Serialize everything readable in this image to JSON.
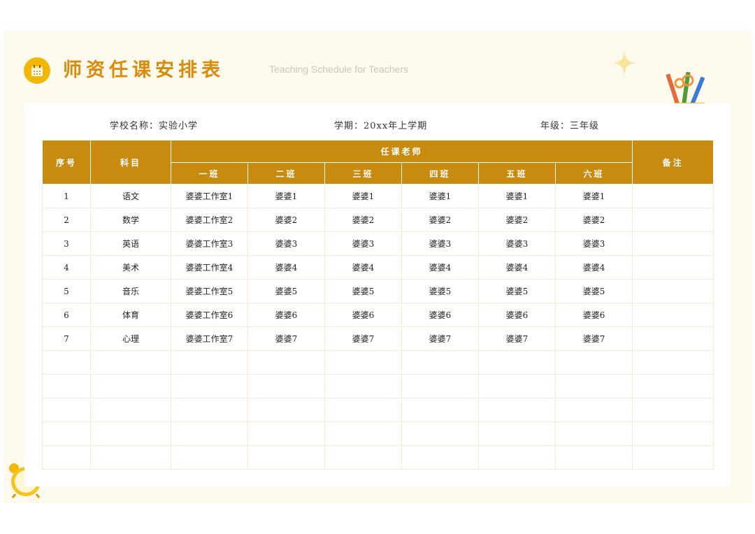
{
  "header": {
    "title": "师资任课安排表",
    "subtitle": "Teaching Schedule for Teachers",
    "icon": "calendar-icon",
    "accent_color": "#d98c0a"
  },
  "info": {
    "school": "学校名称：实验小学",
    "term": "学期：20xx年上学期",
    "grade": "年级：三年级"
  },
  "table": {
    "header_color": "#c98a10",
    "headers": {
      "index": "序号",
      "subject": "科目",
      "teachers": "任课老师",
      "remarks": "备注",
      "classes": [
        "一班",
        "二班",
        "三班",
        "四班",
        "五班",
        "六班"
      ]
    },
    "rows": [
      {
        "index": "1",
        "subject": "语文",
        "c1": "婆婆工作室1",
        "c2": "婆婆1",
        "c3": "婆婆1",
        "c4": "婆婆1",
        "c5": "婆婆1",
        "c6": "婆婆1",
        "remarks": ""
      },
      {
        "index": "2",
        "subject": "数学",
        "c1": "婆婆工作室2",
        "c2": "婆婆2",
        "c3": "婆婆2",
        "c4": "婆婆2",
        "c5": "婆婆2",
        "c6": "婆婆2",
        "remarks": ""
      },
      {
        "index": "3",
        "subject": "英语",
        "c1": "婆婆工作室3",
        "c2": "婆婆3",
        "c3": "婆婆3",
        "c4": "婆婆3",
        "c5": "婆婆3",
        "c6": "婆婆3",
        "remarks": ""
      },
      {
        "index": "4",
        "subject": "美术",
        "c1": "婆婆工作室4",
        "c2": "婆婆4",
        "c3": "婆婆4",
        "c4": "婆婆4",
        "c5": "婆婆4",
        "c6": "婆婆4",
        "remarks": ""
      },
      {
        "index": "5",
        "subject": "音乐",
        "c1": "婆婆工作室5",
        "c2": "婆婆5",
        "c3": "婆婆5",
        "c4": "婆婆5",
        "c5": "婆婆5",
        "c6": "婆婆5",
        "remarks": ""
      },
      {
        "index": "6",
        "subject": "体育",
        "c1": "婆婆工作室6",
        "c2": "婆婆6",
        "c3": "婆婆6",
        "c4": "婆婆6",
        "c5": "婆婆6",
        "c6": "婆婆6",
        "remarks": ""
      },
      {
        "index": "7",
        "subject": "心理",
        "c1": "婆婆工作室7",
        "c2": "婆婆7",
        "c3": "婆婆7",
        "c4": "婆婆7",
        "c5": "婆婆7",
        "c6": "婆婆7",
        "remarks": ""
      },
      {
        "index": "",
        "subject": "",
        "c1": "",
        "c2": "",
        "c3": "",
        "c4": "",
        "c5": "",
        "c6": "",
        "remarks": ""
      },
      {
        "index": "",
        "subject": "",
        "c1": "",
        "c2": "",
        "c3": "",
        "c4": "",
        "c5": "",
        "c6": "",
        "remarks": ""
      },
      {
        "index": "",
        "subject": "",
        "c1": "",
        "c2": "",
        "c3": "",
        "c4": "",
        "c5": "",
        "c6": "",
        "remarks": ""
      },
      {
        "index": "",
        "subject": "",
        "c1": "",
        "c2": "",
        "c3": "",
        "c4": "",
        "c5": "",
        "c6": "",
        "remarks": ""
      },
      {
        "index": "",
        "subject": "",
        "c1": "",
        "c2": "",
        "c3": "",
        "c4": "",
        "c5": "",
        "c6": "",
        "remarks": ""
      }
    ]
  },
  "decorations": {
    "sparkle": "sparkle-icon",
    "pencil_cup": "pencil-cup-icon",
    "clock": "alarm-clock-icon"
  }
}
